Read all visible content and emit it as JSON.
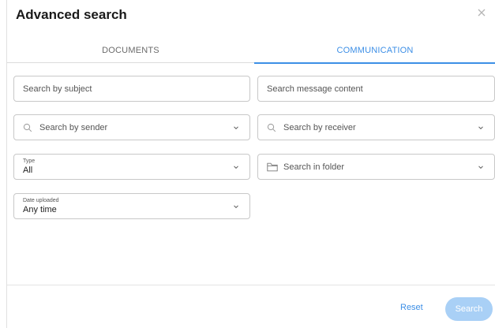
{
  "dialog": {
    "title": "Advanced search"
  },
  "tabs": [
    {
      "label": "DOCUMENTS",
      "active": false
    },
    {
      "label": "COMMUNICATION",
      "active": true
    }
  ],
  "fields": {
    "subject": {
      "placeholder": "Search by subject"
    },
    "content": {
      "placeholder": "Search message content"
    },
    "sender": {
      "placeholder": "Search by sender"
    },
    "receiver": {
      "placeholder": "Search by receiver"
    },
    "type": {
      "label": "Type",
      "value": "All"
    },
    "folder": {
      "placeholder": "Search in folder"
    },
    "date": {
      "label": "Date uploaded",
      "value": "Any time"
    }
  },
  "footer": {
    "reset_label": "Reset",
    "search_label": "Search"
  },
  "colors": {
    "accent": "#3d8fe6",
    "search_button_disabled": "#a9d0f6",
    "border": "#c8c8c8"
  },
  "icons": [
    "close-icon",
    "search-icon",
    "chevron-down-icon",
    "folder-icon"
  ]
}
